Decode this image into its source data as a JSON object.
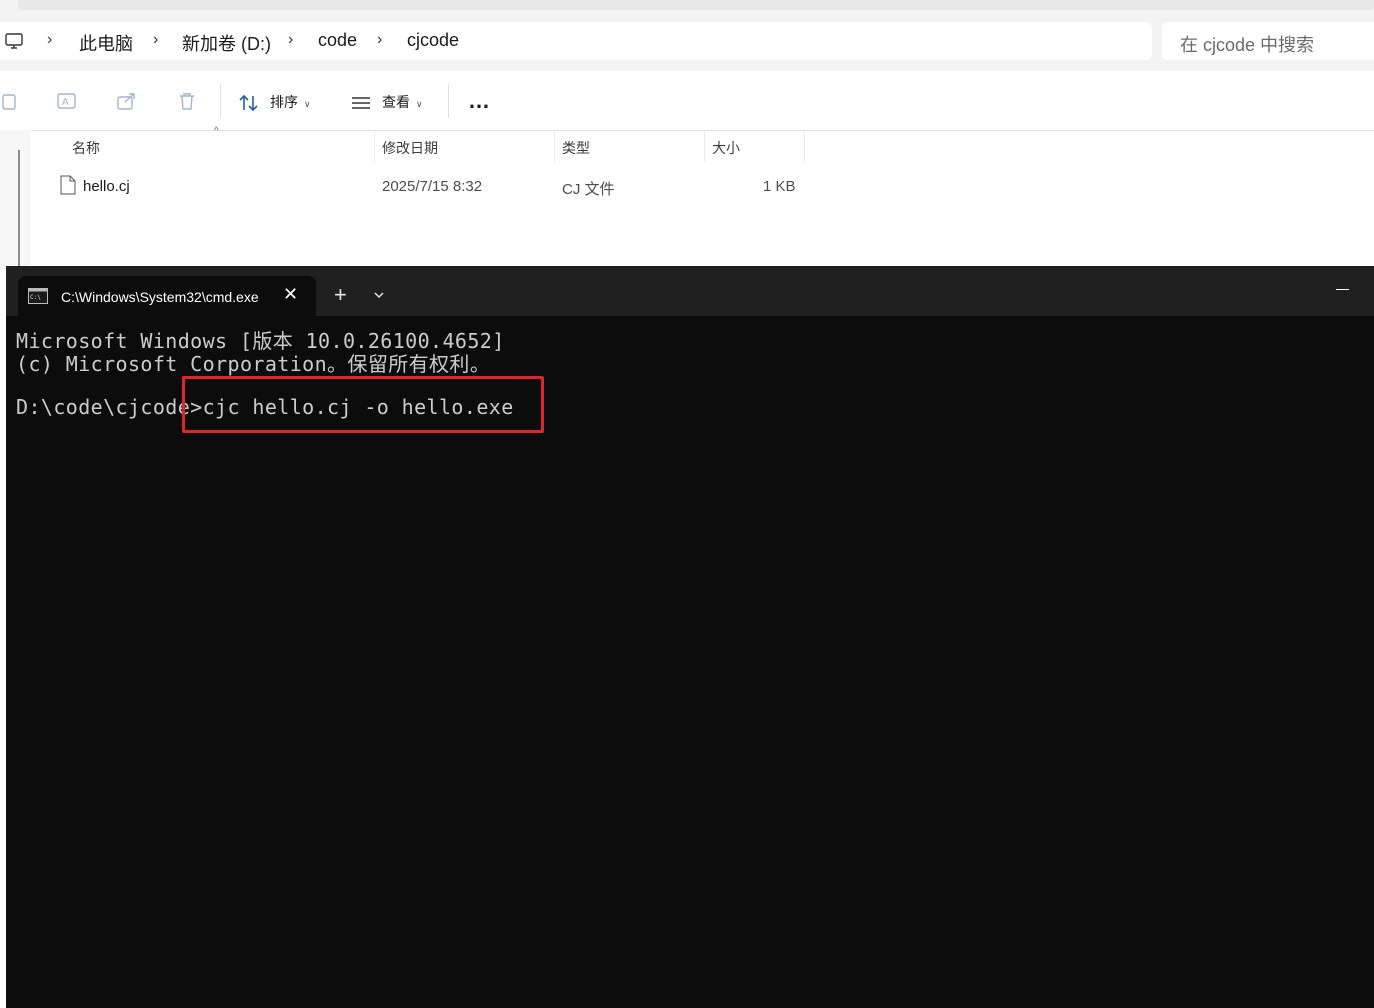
{
  "explorer": {
    "breadcrumb": [
      "此电脑",
      "新加卷 (D:)",
      "code",
      "cjcode"
    ],
    "search_placeholder": "在 cjcode 中搜索",
    "toolbar": {
      "sort_label": "排序",
      "view_label": "查看",
      "more_label": "…"
    },
    "columns": [
      "名称",
      "修改日期",
      "类型",
      "大小"
    ],
    "files": [
      {
        "name": "hello.cj",
        "modified": "2025/7/15 8:32",
        "type": "CJ 文件",
        "size": "1 KB"
      }
    ]
  },
  "terminal": {
    "tab_title": "C:\\Windows\\System32\\cmd.exe",
    "lines": [
      "Microsoft Windows [版本 10.0.26100.4652]",
      "(c) Microsoft Corporation。保留所有权利。",
      "",
      "D:\\code\\cjcode>cjc hello.cj -o hello.exe"
    ]
  },
  "colors": {
    "terminal_bg": "#0c0c0c",
    "terminal_text": "#cccccc",
    "highlight_box": "#e0242c"
  }
}
